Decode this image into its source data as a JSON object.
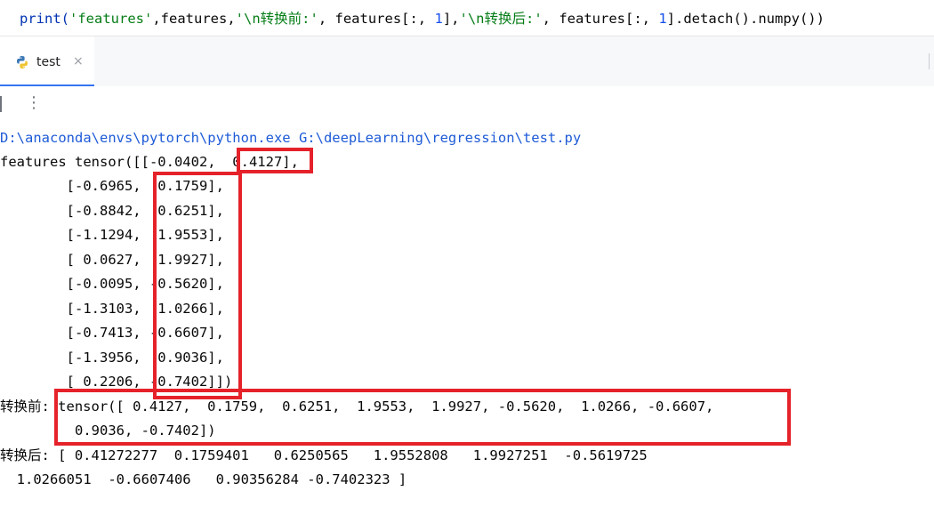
{
  "editor": {
    "code_print": "print(",
    "code_str1": "'features'",
    "code_mid1": ",features,",
    "code_str2": "'\\n转换前:'",
    "code_mid2": ", features[:, ",
    "code_num1": "1",
    "code_mid3": "],",
    "code_str3": "'\\n转换后:'",
    "code_mid4": ", features[:, ",
    "code_num2": "1",
    "code_mid5": "].detach().numpy())"
  },
  "tab": {
    "label": "test",
    "close": "×"
  },
  "toolbar": {
    "more_icon": "⋮"
  },
  "console": {
    "lines": [
      "D:\\anaconda\\envs\\pytorch\\python.exe G:\\deepLearning\\regression\\test.py",
      "features tensor([[-0.0402,  0.4127],",
      "        [-0.6965,  0.1759],",
      "        [-0.8842,  0.6251],",
      "        [-1.1294,  1.9553],",
      "        [ 0.0627,  1.9927],",
      "        [-0.0095, -0.5620],",
      "        [-1.3103,  1.0266],",
      "        [-0.7413, -0.6607],",
      "        [-1.3956,  0.9036],",
      "        [ 0.2206, -0.7402]])",
      "转换前: tensor([ 0.4127,  0.1759,  0.6251,  1.9553,  1.9927, -0.5620,  1.0266, -0.6607,",
      "         0.9036, -0.7402])",
      "转换后: [ 0.41272277  0.1759401   0.6250565   1.9552808   1.9927251  -0.5619725",
      "  1.0266051  -0.6607406   0.90356284 -0.7402323 ]"
    ]
  },
  "colors": {
    "highlight": "#e5222a",
    "tab_underline": "#3574f0"
  }
}
